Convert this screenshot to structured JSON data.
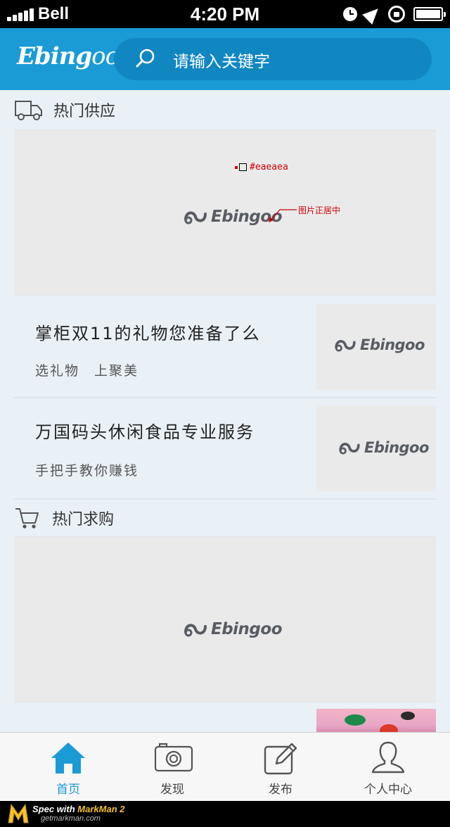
{
  "status_bar": {
    "carrier": "Bell",
    "time": "4:20 PM",
    "icons": [
      "signal-icon",
      "clock-icon",
      "location-icon",
      "rotation-lock-icon",
      "battery-icon"
    ]
  },
  "header": {
    "logo_main": "Ebing",
    "logo_tail": "oo",
    "search_placeholder": "请输入关键字"
  },
  "supply": {
    "title": "热门供应",
    "banner_brand": "Ebingoo",
    "annotation_color": "#eaeaea",
    "annotation_center": "图片正居中",
    "items": [
      {
        "title": "掌柜双11的礼物您准备了么",
        "sub": "选礼物　上聚美",
        "brand": "Ebingoo"
      },
      {
        "title": "万国码头休闲食品专业服务",
        "sub": "手把手教你赚钱",
        "brand": "Ebingoo"
      }
    ]
  },
  "demand": {
    "title": "热门求购",
    "banner_brand": "Ebingoo"
  },
  "tabbar": {
    "tabs": [
      {
        "label": "首页",
        "icon": "home-icon",
        "active": true
      },
      {
        "label": "发现",
        "icon": "camera-icon",
        "active": false
      },
      {
        "label": "发布",
        "icon": "edit-icon",
        "active": false
      },
      {
        "label": "个人中心",
        "icon": "user-icon",
        "active": false
      }
    ]
  },
  "markman": {
    "spec_prefix": "Spec with ",
    "spec_name": "MarkMan 2",
    "url": "getmarkman.com"
  },
  "colors": {
    "brand_blue": "#1a9bd6",
    "search_bg": "#1187c2",
    "page_bg": "#e9f0f6",
    "placeholder_bg": "#eaeaea"
  }
}
